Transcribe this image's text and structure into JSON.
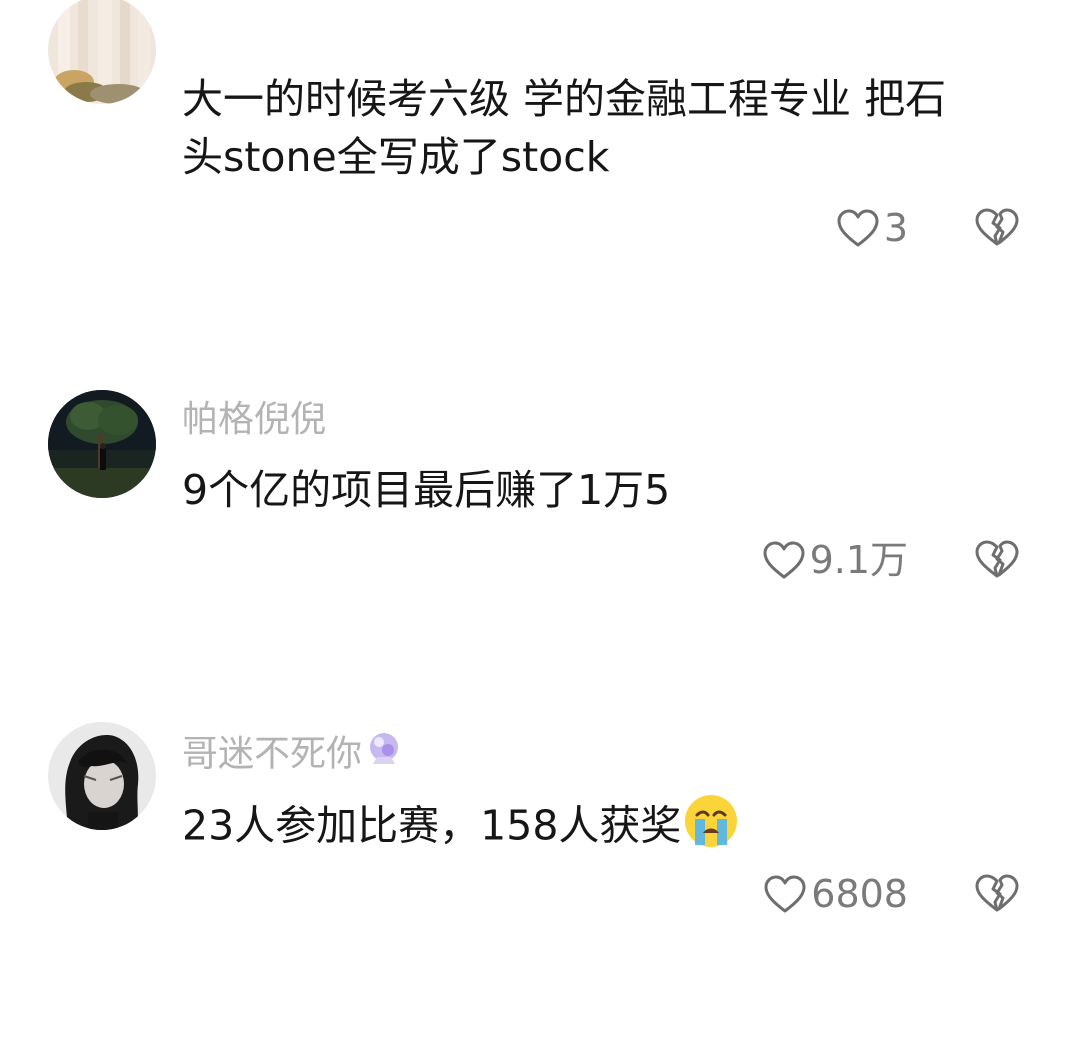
{
  "comments": [
    {
      "username": "",
      "text_line1": "大一的时候考六级 学的金融工程专业 把石",
      "text_line2": "头stone全写成了stock",
      "likes": "3"
    },
    {
      "username": "帕格倪倪",
      "text": "9个亿的项目最后赚了1万5",
      "likes": "9.1万"
    },
    {
      "username": "哥迷不死你",
      "username_badge_icon": "crystal-ball-icon",
      "text": "23人参加比赛，158人获奖",
      "text_emoji": "crying-face-emoji",
      "likes": "6808"
    }
  ],
  "icons": {
    "like": "heart-outline-icon",
    "dislike": "broken-heart-outline-icon"
  },
  "colors": {
    "text": "#161616",
    "username": "#b3b3b3",
    "count": "#7a7a7a",
    "icon": "#6e6e6e"
  }
}
